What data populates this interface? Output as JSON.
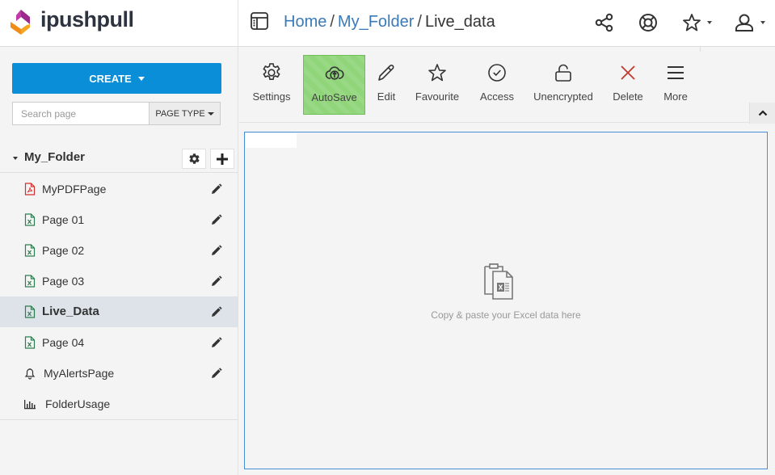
{
  "brand": {
    "name": "ipushpull"
  },
  "header": {
    "breadcrumb": [
      {
        "label": "Home",
        "link": true
      },
      {
        "label": "My_Folder",
        "link": true
      },
      {
        "label": "Live_data",
        "link": false
      }
    ],
    "separator": "/",
    "icons": [
      "share-icon",
      "help-lifebuoy-icon",
      "favourites-star-icon",
      "user-icon"
    ]
  },
  "sidebar": {
    "create_label": "CREATE",
    "search_placeholder": "Search page",
    "search_value": "",
    "page_type_label": "PAGE TYPE",
    "folder": {
      "name": "My_Folder",
      "pages": [
        {
          "label": "MyPDFPage",
          "type": "pdf",
          "editable": true,
          "active": false
        },
        {
          "label": "Page 01",
          "type": "excel",
          "editable": true,
          "active": false
        },
        {
          "label": "Page 02",
          "type": "excel",
          "editable": true,
          "active": false
        },
        {
          "label": "Page 03",
          "type": "excel",
          "editable": true,
          "active": false
        },
        {
          "label": "Live_Data",
          "type": "excel",
          "editable": true,
          "active": true
        },
        {
          "label": "Page 04",
          "type": "excel",
          "editable": true,
          "active": false
        },
        {
          "label": "MyAlertsPage",
          "type": "alert",
          "editable": true,
          "active": false
        },
        {
          "label": "FolderUsage",
          "type": "chart",
          "editable": false,
          "active": false
        }
      ]
    }
  },
  "toolbar": {
    "items": [
      {
        "label": "Settings",
        "icon": "gear-icon"
      },
      {
        "label": "AutoSave",
        "icon": "cloud-upload-icon",
        "active": true
      },
      {
        "label": "Edit",
        "icon": "pencil-icon"
      },
      {
        "label": "Favourite",
        "icon": "star-icon"
      },
      {
        "label": "Access",
        "icon": "check-circle-icon"
      },
      {
        "label": "Unencrypted",
        "icon": "unlock-icon"
      },
      {
        "label": "Delete",
        "icon": "close-icon"
      },
      {
        "label": "More",
        "icon": "menu-icon"
      }
    ]
  },
  "content": {
    "empty_message": "Copy & paste your Excel data here"
  },
  "colors": {
    "primary": "#0b8ed8",
    "link": "#3a7ab8",
    "autosave_active": "#90d57a",
    "delete": "#c0392b",
    "excel": "#2e7d4f",
    "pdf": "#d32f2f",
    "content_border": "#4a8fd6"
  }
}
